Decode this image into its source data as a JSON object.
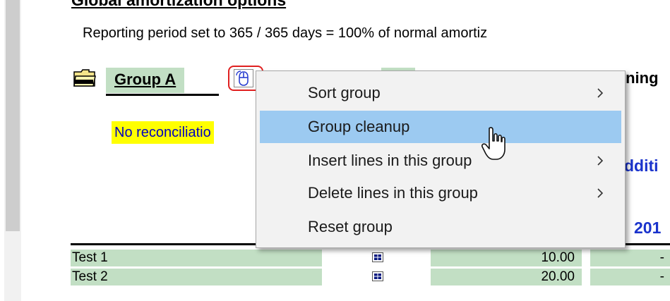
{
  "section": {
    "title": "Global amortization options",
    "reporting_note": "Reporting period set to 365 / 365 days = 100% of normal amortiz"
  },
  "group": {
    "name": "Group A",
    "folder_icon": "folder-icon",
    "menu_button_icon": "mouse-icon",
    "reconciliation_note": "No reconciliatio",
    "header_right_cut": "ining",
    "addition_header_cut": "dditi",
    "year_header_cut": "201"
  },
  "context_menu": {
    "items": [
      {
        "label": "Sort group",
        "has_submenu": true,
        "highlighted": false
      },
      {
        "label": "Group cleanup",
        "has_submenu": false,
        "highlighted": true
      },
      {
        "label": "Insert lines in this group",
        "has_submenu": true,
        "highlighted": false
      },
      {
        "label": "Delete lines in this group",
        "has_submenu": true,
        "highlighted": false
      },
      {
        "label": "Reset group",
        "has_submenu": false,
        "highlighted": false
      }
    ]
  },
  "table": {
    "rows": [
      {
        "name": "Test 1",
        "amount": "10.00",
        "trailing": "-",
        "icon": "calculator-icon"
      },
      {
        "name": "Test 2",
        "amount": "20.00",
        "trailing": "-",
        "icon": "calculator-icon"
      }
    ]
  },
  "colors": {
    "cell_green": "#c2dfc4",
    "highlight_yellow": "#ffff00",
    "link_blue": "#1a33cc",
    "menu_hover": "#9ccaf1",
    "focus_red": "#e02020"
  }
}
